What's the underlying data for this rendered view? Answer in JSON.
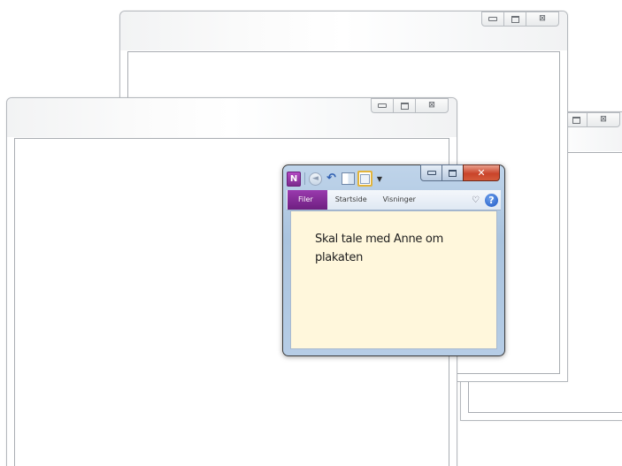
{
  "window_caption_buttons": {
    "minimize_icon": "minimize-icon",
    "maximize_icon": "maximize-icon",
    "close_glyph": "⊠"
  },
  "onenote": {
    "logo_letter": "N",
    "quick_access": {
      "back_glyph": "◄",
      "undo_glyph": "↶",
      "more_glyph": "▼"
    },
    "ribbon": {
      "tabs": [
        {
          "label": "Filer",
          "active": true
        },
        {
          "label": "Startside",
          "active": false
        },
        {
          "label": "Visninger",
          "active": false
        }
      ],
      "expand_glyph": "♡",
      "help_glyph": "?"
    },
    "note": {
      "text": "Skal tale med Anne om plakaten"
    },
    "colors": {
      "accent": "#7c2b8d",
      "note_background": "#fff7dc",
      "close_button": "#c9442a"
    }
  }
}
